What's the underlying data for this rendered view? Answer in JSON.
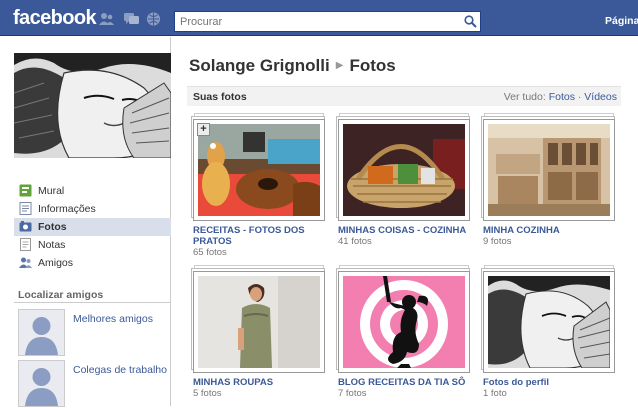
{
  "header": {
    "logo": "facebook",
    "search_placeholder": "Procurar",
    "right_link": "Página"
  },
  "sidebar": {
    "items": [
      {
        "label": "Mural",
        "icon": "wall-icon"
      },
      {
        "label": "Informações",
        "icon": "info-icon"
      },
      {
        "label": "Fotos",
        "icon": "photos-icon",
        "selected": true
      },
      {
        "label": "Notas",
        "icon": "notes-icon"
      },
      {
        "label": "Amigos",
        "icon": "friends-icon"
      }
    ],
    "find_friends_title": "Localizar amigos",
    "friend_lists": [
      {
        "label": "Melhores amigos"
      },
      {
        "label": "Colegas de trabalho"
      }
    ]
  },
  "main": {
    "owner_name": "Solange Grignolli",
    "section": "Fotos",
    "subheader": {
      "left": "Suas fotos",
      "see_all": "Ver tudo:",
      "photos_link": "Fotos",
      "separator": "·",
      "videos_link": "Vídeos"
    },
    "albums": [
      {
        "title": "RECEITAS - FOTOS DOS PRATOS",
        "count": "65 fotos"
      },
      {
        "title": "MINHAS COISAS - COZINHA",
        "count": "41 fotos"
      },
      {
        "title": "MINHA COZINHA",
        "count": "9 fotos"
      },
      {
        "title": "MINHAS ROUPAS",
        "count": "5 fotos"
      },
      {
        "title": "BLOG RECEITAS DA TIA SÔ",
        "count": "7 fotos"
      },
      {
        "title": "Fotos do perfil",
        "count": "1 foto"
      }
    ]
  },
  "colors": {
    "brand_blue": "#3b5998",
    "link_blue": "#3b5998",
    "selected_bg": "#d8dfea"
  }
}
